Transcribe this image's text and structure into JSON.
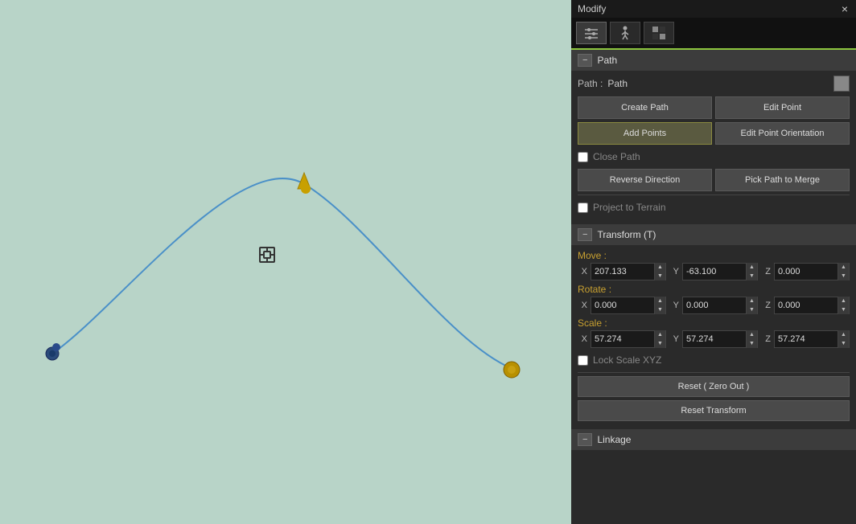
{
  "window": {
    "title": "Modify",
    "close_label": "×"
  },
  "tabs": [
    {
      "id": "sliders",
      "icon": "⚙",
      "active": true
    },
    {
      "id": "figure",
      "icon": "🏃",
      "active": false
    },
    {
      "id": "checkerboard",
      "icon": "⬛",
      "active": false
    }
  ],
  "path_section": {
    "collapse_btn": "−",
    "title": "Path",
    "path_label": "Path :",
    "path_value": "Path",
    "create_path_label": "Create Path",
    "edit_point_label": "Edit Point",
    "add_points_label": "Add Points",
    "edit_point_orientation_label": "Edit Point Orientation",
    "close_path_label": "Close Path",
    "close_path_checked": false,
    "reverse_direction_label": "Reverse Direction",
    "pick_path_to_merge_label": "Pick Path to Merge",
    "project_to_terrain_label": "Project to Terrain",
    "project_to_terrain_checked": false
  },
  "transform_section": {
    "collapse_btn": "−",
    "title": "Transform  (T)",
    "move_label": "Move :",
    "move_x": "207.133",
    "move_y": "-63.100",
    "move_z": "0.000",
    "rotate_label": "Rotate :",
    "rotate_x": "0.000",
    "rotate_y": "0.000",
    "rotate_z": "0.000",
    "scale_label": "Scale :",
    "scale_x": "57.274",
    "scale_y": "57.274",
    "scale_z": "57.274",
    "lock_scale_label": "Lock Scale XYZ",
    "lock_scale_checked": false,
    "reset_zero_label": "Reset ( Zero Out )",
    "reset_transform_label": "Reset Transform"
  },
  "linkage_section": {
    "collapse_btn": "−",
    "title": "Linkage"
  },
  "axis_x": "X",
  "axis_y": "Y",
  "axis_z": "Z"
}
